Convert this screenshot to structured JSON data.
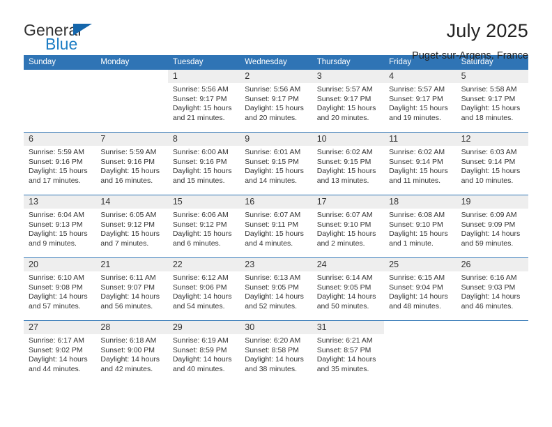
{
  "brand": {
    "word1": "General",
    "word2": "Blue",
    "triangle_color": "#1566ab",
    "blue_color": "#1d7dc4"
  },
  "header": {
    "title": "July 2025",
    "subtitle": "Puget-sur-Argens, France"
  },
  "calendar": {
    "header_bg": "#2f74b5",
    "daynum_bg": "#eeeeee",
    "weekdays": [
      "Sunday",
      "Monday",
      "Tuesday",
      "Wednesday",
      "Thursday",
      "Friday",
      "Saturday"
    ],
    "weeks": [
      [
        {
          "day": "",
          "sunrise": "",
          "sunset": "",
          "daylight1": "",
          "daylight2": ""
        },
        {
          "day": "",
          "sunrise": "",
          "sunset": "",
          "daylight1": "",
          "daylight2": ""
        },
        {
          "day": "1",
          "sunrise": "Sunrise: 5:56 AM",
          "sunset": "Sunset: 9:17 PM",
          "daylight1": "Daylight: 15 hours",
          "daylight2": "and 21 minutes."
        },
        {
          "day": "2",
          "sunrise": "Sunrise: 5:56 AM",
          "sunset": "Sunset: 9:17 PM",
          "daylight1": "Daylight: 15 hours",
          "daylight2": "and 20 minutes."
        },
        {
          "day": "3",
          "sunrise": "Sunrise: 5:57 AM",
          "sunset": "Sunset: 9:17 PM",
          "daylight1": "Daylight: 15 hours",
          "daylight2": "and 20 minutes."
        },
        {
          "day": "4",
          "sunrise": "Sunrise: 5:57 AM",
          "sunset": "Sunset: 9:17 PM",
          "daylight1": "Daylight: 15 hours",
          "daylight2": "and 19 minutes."
        },
        {
          "day": "5",
          "sunrise": "Sunrise: 5:58 AM",
          "sunset": "Sunset: 9:17 PM",
          "daylight1": "Daylight: 15 hours",
          "daylight2": "and 18 minutes."
        }
      ],
      [
        {
          "day": "6",
          "sunrise": "Sunrise: 5:59 AM",
          "sunset": "Sunset: 9:16 PM",
          "daylight1": "Daylight: 15 hours",
          "daylight2": "and 17 minutes."
        },
        {
          "day": "7",
          "sunrise": "Sunrise: 5:59 AM",
          "sunset": "Sunset: 9:16 PM",
          "daylight1": "Daylight: 15 hours",
          "daylight2": "and 16 minutes."
        },
        {
          "day": "8",
          "sunrise": "Sunrise: 6:00 AM",
          "sunset": "Sunset: 9:16 PM",
          "daylight1": "Daylight: 15 hours",
          "daylight2": "and 15 minutes."
        },
        {
          "day": "9",
          "sunrise": "Sunrise: 6:01 AM",
          "sunset": "Sunset: 9:15 PM",
          "daylight1": "Daylight: 15 hours",
          "daylight2": "and 14 minutes."
        },
        {
          "day": "10",
          "sunrise": "Sunrise: 6:02 AM",
          "sunset": "Sunset: 9:15 PM",
          "daylight1": "Daylight: 15 hours",
          "daylight2": "and 13 minutes."
        },
        {
          "day": "11",
          "sunrise": "Sunrise: 6:02 AM",
          "sunset": "Sunset: 9:14 PM",
          "daylight1": "Daylight: 15 hours",
          "daylight2": "and 11 minutes."
        },
        {
          "day": "12",
          "sunrise": "Sunrise: 6:03 AM",
          "sunset": "Sunset: 9:14 PM",
          "daylight1": "Daylight: 15 hours",
          "daylight2": "and 10 minutes."
        }
      ],
      [
        {
          "day": "13",
          "sunrise": "Sunrise: 6:04 AM",
          "sunset": "Sunset: 9:13 PM",
          "daylight1": "Daylight: 15 hours",
          "daylight2": "and 9 minutes."
        },
        {
          "day": "14",
          "sunrise": "Sunrise: 6:05 AM",
          "sunset": "Sunset: 9:12 PM",
          "daylight1": "Daylight: 15 hours",
          "daylight2": "and 7 minutes."
        },
        {
          "day": "15",
          "sunrise": "Sunrise: 6:06 AM",
          "sunset": "Sunset: 9:12 PM",
          "daylight1": "Daylight: 15 hours",
          "daylight2": "and 6 minutes."
        },
        {
          "day": "16",
          "sunrise": "Sunrise: 6:07 AM",
          "sunset": "Sunset: 9:11 PM",
          "daylight1": "Daylight: 15 hours",
          "daylight2": "and 4 minutes."
        },
        {
          "day": "17",
          "sunrise": "Sunrise: 6:07 AM",
          "sunset": "Sunset: 9:10 PM",
          "daylight1": "Daylight: 15 hours",
          "daylight2": "and 2 minutes."
        },
        {
          "day": "18",
          "sunrise": "Sunrise: 6:08 AM",
          "sunset": "Sunset: 9:10 PM",
          "daylight1": "Daylight: 15 hours",
          "daylight2": "and 1 minute."
        },
        {
          "day": "19",
          "sunrise": "Sunrise: 6:09 AM",
          "sunset": "Sunset: 9:09 PM",
          "daylight1": "Daylight: 14 hours",
          "daylight2": "and 59 minutes."
        }
      ],
      [
        {
          "day": "20",
          "sunrise": "Sunrise: 6:10 AM",
          "sunset": "Sunset: 9:08 PM",
          "daylight1": "Daylight: 14 hours",
          "daylight2": "and 57 minutes."
        },
        {
          "day": "21",
          "sunrise": "Sunrise: 6:11 AM",
          "sunset": "Sunset: 9:07 PM",
          "daylight1": "Daylight: 14 hours",
          "daylight2": "and 56 minutes."
        },
        {
          "day": "22",
          "sunrise": "Sunrise: 6:12 AM",
          "sunset": "Sunset: 9:06 PM",
          "daylight1": "Daylight: 14 hours",
          "daylight2": "and 54 minutes."
        },
        {
          "day": "23",
          "sunrise": "Sunrise: 6:13 AM",
          "sunset": "Sunset: 9:05 PM",
          "daylight1": "Daylight: 14 hours",
          "daylight2": "and 52 minutes."
        },
        {
          "day": "24",
          "sunrise": "Sunrise: 6:14 AM",
          "sunset": "Sunset: 9:05 PM",
          "daylight1": "Daylight: 14 hours",
          "daylight2": "and 50 minutes."
        },
        {
          "day": "25",
          "sunrise": "Sunrise: 6:15 AM",
          "sunset": "Sunset: 9:04 PM",
          "daylight1": "Daylight: 14 hours",
          "daylight2": "and 48 minutes."
        },
        {
          "day": "26",
          "sunrise": "Sunrise: 6:16 AM",
          "sunset": "Sunset: 9:03 PM",
          "daylight1": "Daylight: 14 hours",
          "daylight2": "and 46 minutes."
        }
      ],
      [
        {
          "day": "27",
          "sunrise": "Sunrise: 6:17 AM",
          "sunset": "Sunset: 9:02 PM",
          "daylight1": "Daylight: 14 hours",
          "daylight2": "and 44 minutes."
        },
        {
          "day": "28",
          "sunrise": "Sunrise: 6:18 AM",
          "sunset": "Sunset: 9:00 PM",
          "daylight1": "Daylight: 14 hours",
          "daylight2": "and 42 minutes."
        },
        {
          "day": "29",
          "sunrise": "Sunrise: 6:19 AM",
          "sunset": "Sunset: 8:59 PM",
          "daylight1": "Daylight: 14 hours",
          "daylight2": "and 40 minutes."
        },
        {
          "day": "30",
          "sunrise": "Sunrise: 6:20 AM",
          "sunset": "Sunset: 8:58 PM",
          "daylight1": "Daylight: 14 hours",
          "daylight2": "and 38 minutes."
        },
        {
          "day": "31",
          "sunrise": "Sunrise: 6:21 AM",
          "sunset": "Sunset: 8:57 PM",
          "daylight1": "Daylight: 14 hours",
          "daylight2": "and 35 minutes."
        },
        {
          "day": "",
          "sunrise": "",
          "sunset": "",
          "daylight1": "",
          "daylight2": ""
        },
        {
          "day": "",
          "sunrise": "",
          "sunset": "",
          "daylight1": "",
          "daylight2": ""
        }
      ]
    ]
  }
}
